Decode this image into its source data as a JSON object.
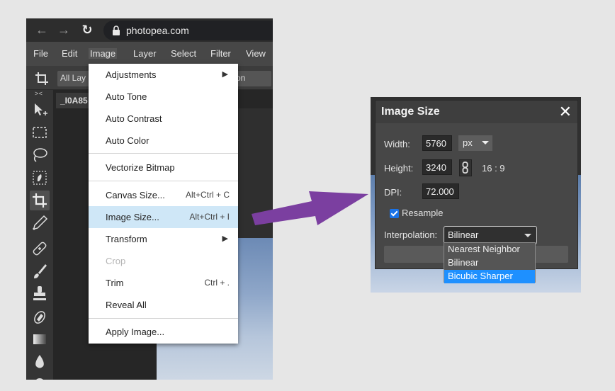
{
  "browser": {
    "url": "photopea.com"
  },
  "menubar": {
    "items": [
      "File",
      "Edit",
      "Image",
      "Layer",
      "Select",
      "Filter",
      "View"
    ]
  },
  "options_bar": {
    "layers_select": "All Lay",
    "button_partial": "on"
  },
  "toolbar": {
    "collapse_toggle": "> <"
  },
  "document": {
    "tab_title": "_I0A85"
  },
  "image_menu": {
    "items": [
      {
        "label": "Adjustments",
        "shortcut": "",
        "submenu": true
      },
      {
        "label": "Auto Tone",
        "shortcut": ""
      },
      {
        "label": "Auto Contrast",
        "shortcut": ""
      },
      {
        "label": "Auto Color",
        "shortcut": ""
      },
      {
        "label": "Vectorize Bitmap",
        "shortcut": ""
      },
      {
        "label": "Canvas Size...",
        "shortcut": "Alt+Ctrl + C"
      },
      {
        "label": "Image Size...",
        "shortcut": "Alt+Ctrl + I"
      },
      {
        "label": "Transform",
        "shortcut": "",
        "submenu": true
      },
      {
        "label": "Crop",
        "shortcut": "",
        "disabled": true
      },
      {
        "label": "Trim",
        "shortcut": "Ctrl + ."
      },
      {
        "label": "Reveal All",
        "shortcut": ""
      },
      {
        "label": "Apply Image...",
        "shortcut": ""
      }
    ],
    "highlighted": "Image Size..."
  },
  "dialog": {
    "title": "Image Size",
    "width_label": "Width:",
    "width_value": "5760",
    "unit": "px",
    "height_label": "Height:",
    "height_value": "3240",
    "ratio": "16 : 9",
    "dpi_label": "DPI:",
    "dpi_value": "72.000",
    "resample_label": "Resample",
    "resample_checked": true,
    "interpolation_label": "Interpolation:",
    "interpolation_value": "Bilinear",
    "interpolation_options": [
      "Nearest Neighbor",
      "Bilinear",
      "Bicubic Sharper"
    ],
    "interpolation_highlighted": "Bicubic Sharper"
  },
  "colors": {
    "arrow": "#7b3fa0",
    "menu_highlight": "#cfe7f7",
    "option_highlight": "#1e90ff",
    "checkbox": "#1a73e8"
  }
}
